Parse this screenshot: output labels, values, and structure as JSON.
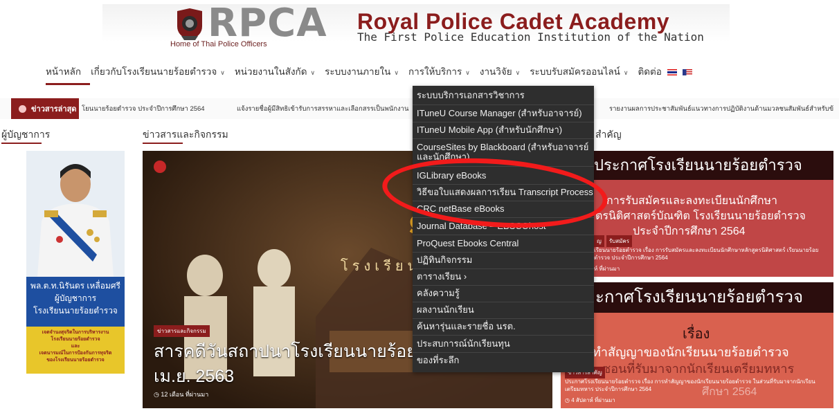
{
  "header": {
    "logo_text": "RPCA",
    "logo_tagline": "Home of Thai Police Officers",
    "title": "Royal Police Cadet Academy",
    "subtitle": "The First Police Education Institution of the Nation"
  },
  "nav": {
    "items": [
      {
        "label": "หน้าหลัก",
        "chevron": false
      },
      {
        "label": "เกี่ยวกับโรงเรียนนายร้อยตำรวจ",
        "chevron": true
      },
      {
        "label": "หน่วยงานในสังกัด",
        "chevron": true
      },
      {
        "label": "ระบบงานภายใน",
        "chevron": true
      },
      {
        "label": "การให้บริการ",
        "chevron": true
      },
      {
        "label": "งานวิจัย",
        "chevron": true
      },
      {
        "label": "ระบบรับสมัครออนไลน์",
        "chevron": true
      },
      {
        "label": "ติดต่อ",
        "chevron": false
      }
    ]
  },
  "ticker": {
    "label": "ข่าวสารล่าสุด",
    "items": [
      "โยนนายร้อยตำรวจ ประจำปีการศึกษา 2564",
      "แจ้งรายชื่อผู้มีสิทธิเข้ารับการสรรหาและเลือกสรรเป็นพนักงาน",
      "รายงานผลการประชาสัมพันธ์แนวทางการปฏิบัติงานด้านมวลชนสัมพันธ์สำหรับข้"
    ]
  },
  "sections": {
    "left": "ผู้บัญชาการ",
    "middle": "ข่าวสารและกิจกรรม",
    "right": "สำคัญ"
  },
  "director": {
    "name": "พล.ต.ท.นิรันดร เหลื่อมศรี",
    "role": "ผู้บัญชาการ",
    "org": "โรงเรียนนายร้อยตำรวจ",
    "banner_lines": [
      "เจตจำนงสุจริตในการบริหารงาน",
      "โรงเรียนนายร้อยตำรวจ",
      "และ",
      "เจตนารมณ์ในการป้องกันการทุจริต",
      "ของโรงเรียนนายร้อยตำรวจ"
    ]
  },
  "hero": {
    "tag": "ข่าวสารและกิจกรรม",
    "title_line1": "สารคดีวันสถาปนาโรงเรียนนายร้อยต",
    "title_line2": "เม.ย. 2563",
    "time": "12 เดือน ที่ผ่านมา",
    "inner_text": "โรงเรียนน"
  },
  "announcements": [
    {
      "header": "ประกาศโรงเรียนนายร้อยตำรวจ",
      "line1": "การรับสมัครและลงทะเบียนนักศึกษา",
      "line2": "ตรนิติศาสตร์บัณฑิต โรงเรียนนายร้อยตำรวจ",
      "line3": "ประจำปีการศึกษา 2564",
      "tags": [
        "ญ",
        "รับสมัคร"
      ],
      "desc": "เรียนนายร้อยตำรวจ เรื่อง การรับสมัครและลงทะเบียนนักศึกษาหลักสูตรนิติศาสตร์ เรียนนายร้อยตำรวจ ประจำปีการศึกษา 2564",
      "time": "ห์ ที่ผ่านมา"
    },
    {
      "header": "ะกาศโรงเรียนนายร้อยตำรวจ",
      "line1": "เรื่อง",
      "line2": "ทำสัญญาของนักเรียนนายร้อยตำรวจ",
      "line3": "ซอนที่รับมาจากนักเรียนเตรียมทหาร",
      "line4": "ศึกษา 2564",
      "tag": "ข่าวสารสำคัญ",
      "desc": "ประกาศโรงเรียนนายร้อยตำรวจ เรื่อง การทำสัญญาของนักเรียนนายร้อยตำรวจ ในส่วนที่รับมาจากนักเรียนเตรียมทหาร ประจำปีการศึกษา 2564",
      "time": "4 สัปดาห์ ที่ผ่านมา"
    }
  ],
  "dropdown": {
    "items": [
      "ระบบบริการเอกสารวิชาการ",
      "ITuneU Course Manager (สำหรับอาจารย์)",
      "ITuneU Mobile App (สำหรับนักศึกษา)",
      "CourseSites by Blackboard (สำหรับอาจารย์",
      "และนักศึกษา)",
      "IGLibrary eBooks",
      "วิธีขอใบแสดงผลการเรียน Transcript Process",
      "CRC netBase eBooks",
      "Journal Database – EBSCOhost",
      "ProQuest Ebooks Central",
      "ปฏิทินกิจกรรม",
      "ตารางเรียน  ›",
      "คลังความรู้",
      "ผลงานนักเรียน",
      "ค้นหารุ่นและรายชื่อ นรต.",
      "ประสบการณ์นักเรียนทุน",
      "ของที่ระลึก"
    ]
  },
  "colors": {
    "brand": "#8b1d1d",
    "menu_bg": "#2e2e2e",
    "annotation": "#f21b1b"
  }
}
